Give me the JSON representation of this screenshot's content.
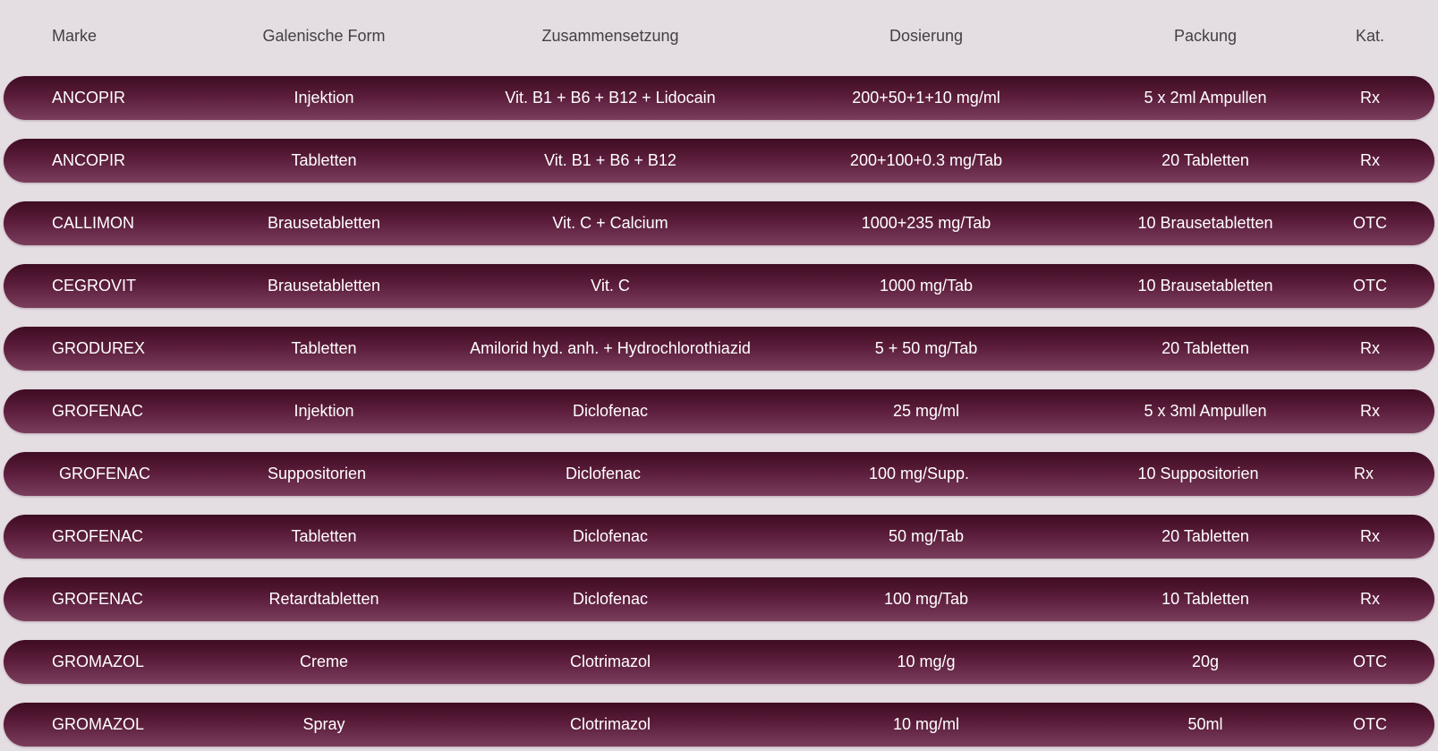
{
  "table": {
    "headers": {
      "marke": "Marke",
      "form": "Galenische Form",
      "zusammensetzung": "Zusammensetzung",
      "dosierung": "Dosierung",
      "packung": "Packung",
      "kat": "Kat."
    },
    "rows": [
      {
        "marke": "ANCOPIR",
        "form": "Injektion",
        "zusammensetzung": "Vit. B1 + B6 + B12 + Lidocain",
        "dosierung": "200+50+1+10 mg/ml",
        "packung": "5 x 2ml Ampullen",
        "kat": "Rx"
      },
      {
        "marke": "ANCOPIR",
        "form": "Tabletten",
        "zusammensetzung": "Vit. B1 + B6 + B12",
        "dosierung": "200+100+0.3 mg/Tab",
        "packung": "20 Tabletten",
        "kat": "Rx"
      },
      {
        "marke": "CALLIMON",
        "form": "Brausetabletten",
        "zusammensetzung": "Vit. C + Calcium",
        "dosierung": "1000+235 mg/Tab",
        "packung": "10 Brausetabletten",
        "kat": "OTC"
      },
      {
        "marke": "CEGROVIT",
        "form": "Brausetabletten",
        "zusammensetzung": "Vit. C",
        "dosierung": "1000 mg/Tab",
        "packung": "10 Brausetabletten",
        "kat": "OTC"
      },
      {
        "marke": "GRODUREX",
        "form": "Tabletten",
        "zusammensetzung": "Amilorid hyd. anh. + Hydrochlorothiazid",
        "dosierung": "5 + 50 mg/Tab",
        "packung": "20 Tabletten",
        "kat": "Rx"
      },
      {
        "marke": "GROFENAC",
        "form": "Injektion",
        "zusammensetzung": "Diclofenac",
        "dosierung": "25 mg/ml",
        "packung": "5 x 3ml Ampullen",
        "kat": "Rx"
      },
      {
        "marke": "GROFENAC",
        "form": "Suppositorien",
        "zusammensetzung": "Diclofenac",
        "dosierung": "100 mg/Supp.",
        "packung": "10 Suppositorien",
        "kat": "Rx"
      },
      {
        "marke": "GROFENAC",
        "form": "Tabletten",
        "zusammensetzung": "Diclofenac",
        "dosierung": "50 mg/Tab",
        "packung": "20 Tabletten",
        "kat": "Rx"
      },
      {
        "marke": "GROFENAC",
        "form": "Retardtabletten",
        "zusammensetzung": "Diclofenac",
        "dosierung": "100 mg/Tab",
        "packung": "10 Tabletten",
        "kat": "Rx"
      },
      {
        "marke": "GROMAZOL",
        "form": "Creme",
        "zusammensetzung": "Clotrimazol",
        "dosierung": "10 mg/g",
        "packung": "20g",
        "kat": "OTC"
      },
      {
        "marke": "GROMAZOL",
        "form": "Spray",
        "zusammensetzung": "Clotrimazol",
        "dosierung": "10 mg/ml",
        "packung": "50ml",
        "kat": "OTC"
      }
    ]
  },
  "colors": {
    "background": "#e4dde2",
    "row_top": "#3e0c22",
    "row_bottom": "#7a3e5c",
    "row_text": "#ffffff",
    "header_text": "#444044"
  }
}
